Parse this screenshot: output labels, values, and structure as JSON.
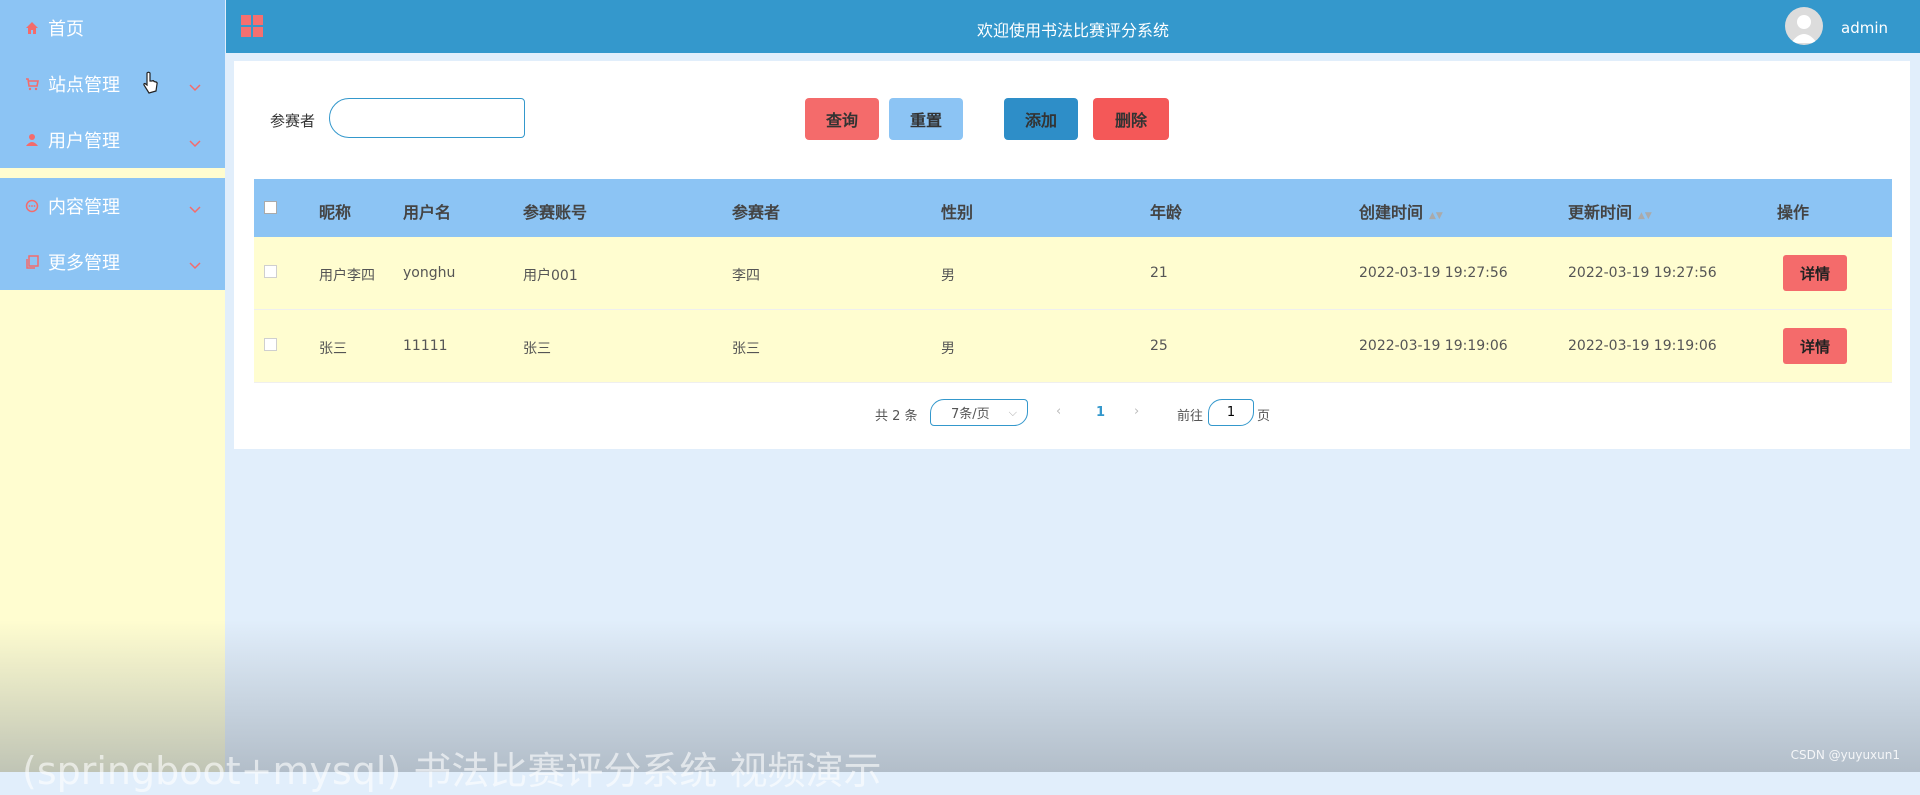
{
  "sidebar": {
    "items": [
      {
        "label": "首页",
        "icon": "home-icon"
      },
      {
        "label": "站点管理",
        "icon": "cart-icon"
      },
      {
        "label": "用户管理",
        "icon": "user-icon"
      },
      {
        "label": "内容管理",
        "icon": "chat-icon"
      },
      {
        "label": "更多管理",
        "icon": "copy-icon"
      }
    ]
  },
  "header": {
    "title": "欢迎使用书法比赛评分系统",
    "username": "admin"
  },
  "search": {
    "label": "参赛者",
    "value": "",
    "placeholder": ""
  },
  "toolbar": {
    "query_label": "查询",
    "reset_label": "重置",
    "add_label": "添加",
    "delete_label": "删除"
  },
  "table": {
    "columns": [
      "昵称",
      "用户名",
      "参赛账号",
      "参赛者",
      "性别",
      "年龄",
      "创建时间",
      "更新时间",
      "操作"
    ],
    "rows": [
      {
        "nickname": "用户李四",
        "username": "yonghu",
        "account": "用户001",
        "contestant": "李四",
        "gender": "男",
        "age": "21",
        "created": "2022-03-19 19:27:56",
        "updated": "2022-03-19 19:27:56",
        "action": "详情"
      },
      {
        "nickname": "张三",
        "username": "11111",
        "account": "张三",
        "contestant": "张三",
        "gender": "男",
        "age": "25",
        "created": "2022-03-19 19:19:06",
        "updated": "2022-03-19 19:19:06",
        "action": "详情"
      }
    ]
  },
  "pagination": {
    "total": "共 2 条",
    "page_size": "7条/页",
    "current": "1",
    "goto_label": "前往",
    "goto_value": "1",
    "page_unit": "页"
  },
  "overlay": {
    "caption": "(springboot+mysql) 书法比赛评分系统 视频演示",
    "watermark": "CSDN @yuyuxun1"
  },
  "colors": {
    "sidebar_menu": "#8cc4f4",
    "sidebar_bg": "#fffdd0",
    "topbar": "#3498cc",
    "page_bg": "#e1eefb",
    "danger": "#f46b6b",
    "primary": "#2e8ec8"
  }
}
